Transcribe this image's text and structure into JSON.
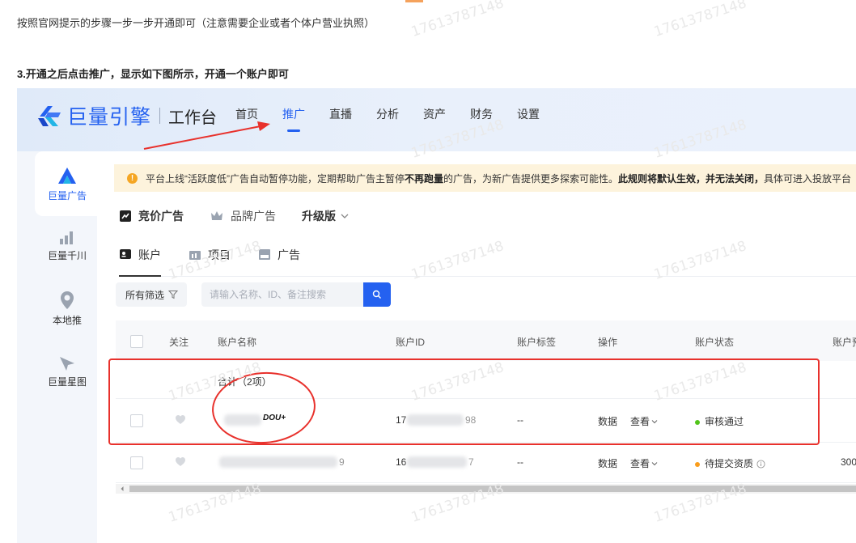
{
  "article": {
    "intro_text": "按照官网提示的步骤一步一步开通即可（注意需要企业或者个体户营业执照）",
    "step3_title": "3.开通之后点击推广，显示如下图所示，开通一个账户即可",
    "watermark_text": "17613787148"
  },
  "header": {
    "brand": "巨量引擎",
    "workbench": "工作台",
    "nav": [
      {
        "label": "首页",
        "active": false
      },
      {
        "label": "推广",
        "active": true
      },
      {
        "label": "直播",
        "active": false
      },
      {
        "label": "分析",
        "active": false
      },
      {
        "label": "资产",
        "active": false
      },
      {
        "label": "财务",
        "active": false
      },
      {
        "label": "设置",
        "active": false
      }
    ]
  },
  "sidebar": {
    "items": [
      {
        "label": "巨量广告",
        "icon": "ad-logo-icon",
        "active": true
      },
      {
        "label": "巨量千川",
        "icon": "bar-chart-icon",
        "active": false
      },
      {
        "label": "本地推",
        "icon": "location-pin-icon",
        "active": false
      },
      {
        "label": "巨量星图",
        "icon": "star-map-icon",
        "active": false
      }
    ]
  },
  "notice": {
    "part1": "平台上线“活跃度低”广告自动暂停功能，定期帮助广告主暂停",
    "bold1": "不再跑量",
    "part2": "的广告，为新广告提供更多探索可能性。",
    "bold2": "此规则将默认生效，并无法关闭，",
    "part3": "具体可进入投放平台"
  },
  "ad_types": {
    "bidding": "竞价广告",
    "brand": "品牌广告",
    "upgrade": "升级版"
  },
  "tabs": [
    {
      "label": "账户",
      "active": true
    },
    {
      "label": "项目",
      "active": false
    },
    {
      "label": "广告",
      "active": false
    }
  ],
  "filter": {
    "all_filter_label": "所有筛选",
    "search_placeholder": "请输入名称、ID、备注搜索"
  },
  "table": {
    "headers": {
      "follow": "关注",
      "account_name": "账户名称",
      "account_id": "账户ID",
      "account_tag": "账户标签",
      "operation": "操作",
      "account_status": "账户状态",
      "account_budget": "账户预"
    },
    "summary": "合计（2项）",
    "rows": [
      {
        "name_suffix": "DOU+",
        "id_prefix": "17",
        "id_suffix": "98",
        "tag": "--",
        "op_data": "数据",
        "op_view": "查看",
        "status": "审核通过",
        "status_color": "#52c41a",
        "budget": ""
      },
      {
        "name_suffix": "9",
        "id_prefix": "16",
        "id_suffix": "7",
        "tag": "--",
        "op_data": "数据",
        "op_view": "查看",
        "status": "待提交资质",
        "status_color": "#fa9d1c",
        "budget": "300"
      }
    ]
  },
  "colors": {
    "accent": "#2461f0",
    "annotation_red": "#e8312c",
    "notice_bg": "#fdf3dc"
  }
}
